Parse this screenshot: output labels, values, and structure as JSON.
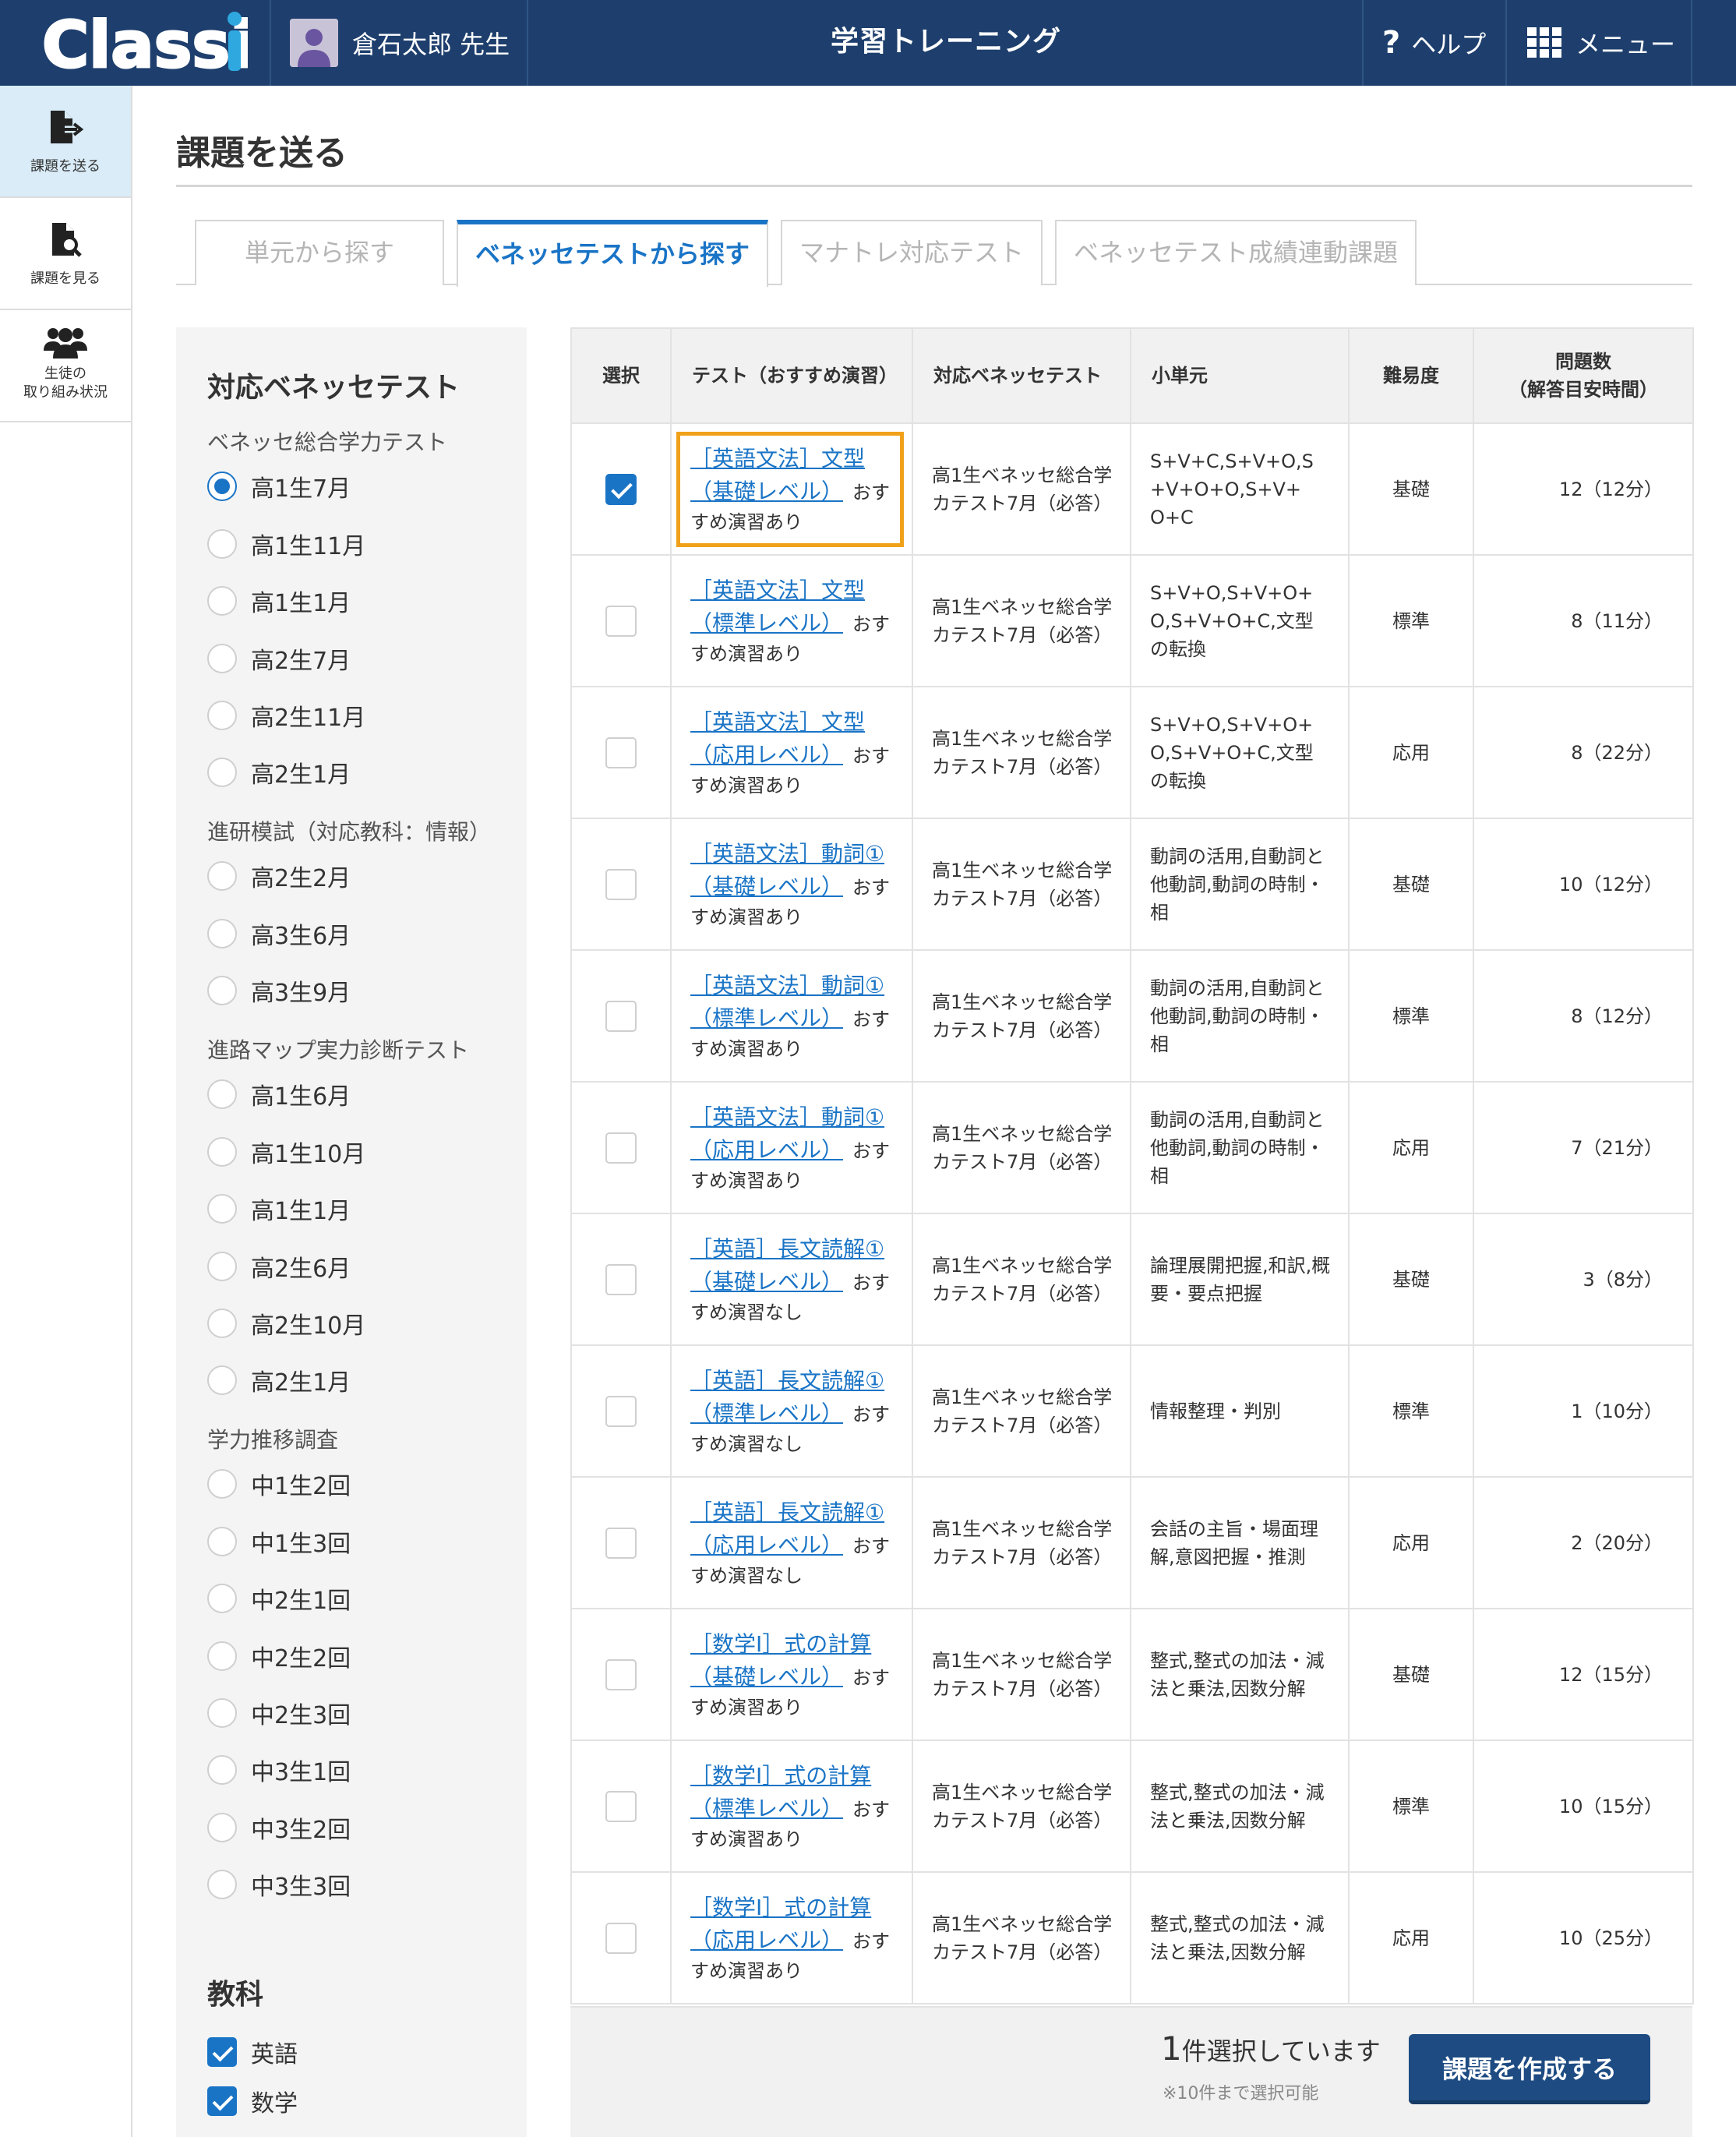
{
  "header": {
    "logo_text": "Classi",
    "user_name": "倉石太郎 先生",
    "app_title": "学習トレーニング",
    "help_label": "ヘルプ",
    "menu_label": "メニュー",
    "bg_color": "#1e3f6d"
  },
  "leftnav": {
    "items": [
      {
        "label": "課題を送る",
        "icon": "send-file-icon",
        "active": true
      },
      {
        "label": "課題を見る",
        "icon": "search-file-icon",
        "active": false
      },
      {
        "label_line1": "生徒の",
        "label_line2": "取り組み状況",
        "icon": "users-icon",
        "active": false
      }
    ]
  },
  "page": {
    "title": "課題を送る"
  },
  "tabs": [
    {
      "label": "単元から探す",
      "active": false
    },
    {
      "label": "ベネッセテストから探す",
      "active": true
    },
    {
      "label": "マナトレ対応テスト",
      "active": false
    },
    {
      "label": "ベネッセテスト成績連動課題",
      "active": false
    }
  ],
  "filter": {
    "heading": "対応ベネッセテスト",
    "groups": [
      {
        "name": "ベネッセ総合学力テスト",
        "options": [
          "高1生7月",
          "高1生11月",
          "高1生1月",
          "高2生7月",
          "高2生11月",
          "高2生1月"
        ],
        "selected": "高1生7月"
      },
      {
        "name": "進研模試（対応教科：情報）",
        "options": [
          "高2生2月",
          "高3生6月",
          "高3生9月"
        ]
      },
      {
        "name": "進路マップ実力診断テスト",
        "options": [
          "高1生6月",
          "高1生10月",
          "高1生1月",
          "高2生6月",
          "高2生10月",
          "高2生1月"
        ]
      },
      {
        "name": "学力推移調査",
        "options": [
          "中1生2回",
          "中1生3回",
          "中2生1回",
          "中2生2回",
          "中2生3回",
          "中3生1回",
          "中3生2回",
          "中3生3回"
        ]
      }
    ],
    "subject_heading": "教科",
    "subjects": [
      {
        "label": "英語",
        "checked": true
      },
      {
        "label": "数学",
        "checked": true
      }
    ]
  },
  "table": {
    "headers": {
      "select": "選択",
      "test": "テスト（おすすめ演習）",
      "benesse": "対応ベネッセテスト",
      "unit": "小単元",
      "difficulty": "難易度",
      "count_line1": "問題数",
      "count_line2": "（解答目安時間）"
    },
    "rows": [
      {
        "checked": true,
        "link1": "［英語文法］文型",
        "link2": "（基礎レベル）",
        "note1": "おす",
        "note2": "すめ演習あり",
        "benesse1": "高1生ベネッセ総合学",
        "benesse2": "カテスト7月（必答）",
        "unit1": "S+V+C,S+V+O,S",
        "unit2": "+V+O+O,S+V+",
        "unit3": "O+C",
        "difficulty": "基礎",
        "count": "12（12分）"
      },
      {
        "checked": false,
        "link1": "［英語文法］文型",
        "link2": "（標準レベル）",
        "note1": "おす",
        "note2": "すめ演習あり",
        "benesse1": "高1生ベネッセ総合学",
        "benesse2": "カテスト7月（必答）",
        "unit1": "S+V+O,S+V+O+",
        "unit2": "O,S+V+O+C,文型",
        "unit3": "の転換",
        "difficulty": "標準",
        "count": "8（11分）"
      },
      {
        "checked": false,
        "link1": "［英語文法］文型",
        "link2": "（応用レベル）",
        "note1": "おす",
        "note2": "すめ演習あり",
        "benesse1": "高1生ベネッセ総合学",
        "benesse2": "カテスト7月（必答）",
        "unit1": "S+V+O,S+V+O+",
        "unit2": "O,S+V+O+C,文型",
        "unit3": "の転換",
        "difficulty": "応用",
        "count": "8（22分）"
      },
      {
        "checked": false,
        "link1": "［英語文法］動詞①",
        "link2": "（基礎レベル）",
        "note1": "おす",
        "note2": "すめ演習あり",
        "benesse1": "高1生ベネッセ総合学",
        "benesse2": "カテスト7月（必答）",
        "unit1": "動詞の活用,自動詞と",
        "unit2": "他動詞,動詞の時制・",
        "unit3": "相",
        "difficulty": "基礎",
        "count": "10（12分）"
      },
      {
        "checked": false,
        "link1": "［英語文法］動詞①",
        "link2": "（標準レベル）",
        "note1": "おす",
        "note2": "すめ演習あり",
        "benesse1": "高1生ベネッセ総合学",
        "benesse2": "カテスト7月（必答）",
        "unit1": "動詞の活用,自動詞と",
        "unit2": "他動詞,動詞の時制・",
        "unit3": "相",
        "difficulty": "標準",
        "count": "8（12分）"
      },
      {
        "checked": false,
        "link1": "［英語文法］動詞①",
        "link2": "（応用レベル）",
        "note1": "おす",
        "note2": "すめ演習あり",
        "benesse1": "高1生ベネッセ総合学",
        "benesse2": "カテスト7月（必答）",
        "unit1": "動詞の活用,自動詞と",
        "unit2": "他動詞,動詞の時制・",
        "unit3": "相",
        "difficulty": "応用",
        "count": "7（21分）"
      },
      {
        "checked": false,
        "link1": "［英語］長文読解①",
        "link2": "（基礎レベル）",
        "note1": "おす",
        "note2": "すめ演習なし",
        "benesse1": "高1生ベネッセ総合学",
        "benesse2": "カテスト7月（必答）",
        "unit1": "論理展開把握,和訳,概",
        "unit2": "要・要点把握",
        "unit3": "",
        "difficulty": "基礎",
        "count": "3（8分）"
      },
      {
        "checked": false,
        "link1": "［英語］長文読解①",
        "link2": "（標準レベル）",
        "note1": "おす",
        "note2": "すめ演習なし",
        "benesse1": "高1生ベネッセ総合学",
        "benesse2": "カテスト7月（必答）",
        "unit1": "情報整理・判別",
        "unit2": "",
        "unit3": "",
        "difficulty": "標準",
        "count": "1（10分）"
      },
      {
        "checked": false,
        "link1": "［英語］長文読解①",
        "link2": "（応用レベル）",
        "note1": "おす",
        "note2": "すめ演習なし",
        "benesse1": "高1生ベネッセ総合学",
        "benesse2": "カテスト7月（必答）",
        "unit1": "会話の主旨・場面理",
        "unit2": "解,意図把握・推測",
        "unit3": "",
        "difficulty": "応用",
        "count": "2（20分）"
      },
      {
        "checked": false,
        "link1": "［数学Ⅰ］式の計算",
        "link2": "（基礎レベル）",
        "note1": "おす",
        "note2": "すめ演習あり",
        "benesse1": "高1生ベネッセ総合学",
        "benesse2": "カテスト7月（必答）",
        "unit1": "整式,整式の加法・減",
        "unit2": "法と乗法,因数分解",
        "unit3": "",
        "difficulty": "基礎",
        "count": "12（15分）"
      },
      {
        "checked": false,
        "link1": "［数学Ⅰ］式の計算",
        "link2": "（標準レベル）",
        "note1": "おす",
        "note2": "すめ演習あり",
        "benesse1": "高1生ベネッセ総合学",
        "benesse2": "カテスト7月（必答）",
        "unit1": "整式,整式の加法・減",
        "unit2": "法と乗法,因数分解",
        "unit3": "",
        "difficulty": "標準",
        "count": "10（15分）"
      },
      {
        "checked": false,
        "link1": "［数学Ⅰ］式の計算",
        "link2": "（応用レベル）",
        "note1": "おす",
        "note2": "すめ演習あり",
        "benesse1": "高1生ベネッセ総合学",
        "benesse2": "カテスト7月（必答）",
        "unit1": "整式,整式の加法・減",
        "unit2": "法と乗法,因数分解",
        "unit3": "",
        "difficulty": "応用",
        "count": "10（25分）"
      }
    ]
  },
  "footer": {
    "count_number": "1",
    "count_text": "件選択しています",
    "note": "※10件まで選択可能",
    "create_label": "課題を作成する"
  }
}
